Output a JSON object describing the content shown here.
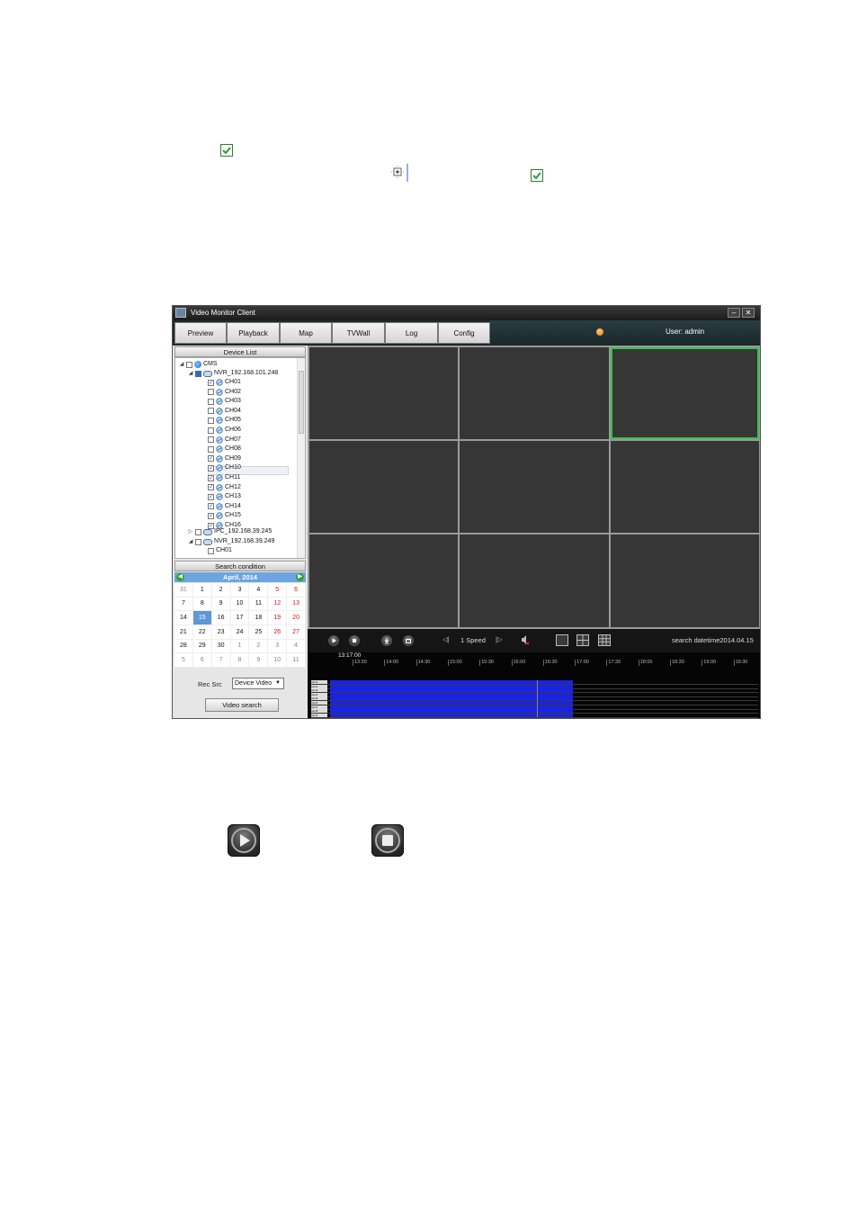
{
  "app": {
    "title": "Video Monitor Client",
    "nav_tabs": [
      "Preview",
      "Playback",
      "Map",
      "TVWall",
      "Log",
      "Config"
    ],
    "user": "User: admin",
    "colors": {
      "accent_active": "#35c24a",
      "record_bar": "#1a24e0",
      "calendar_header": "#6da5e0",
      "weekend": "#d11111"
    }
  },
  "device_list": {
    "header": "Device List",
    "root": "CMS",
    "devices": [
      {
        "name": "NVR_192.168.101.248",
        "expanded": true,
        "channels": [
          {
            "name": "CH01",
            "checked": true
          },
          {
            "name": "CH02",
            "checked": false
          },
          {
            "name": "CH03",
            "checked": false
          },
          {
            "name": "CH04",
            "checked": false
          },
          {
            "name": "CH05",
            "checked": false
          },
          {
            "name": "CH06",
            "checked": false
          },
          {
            "name": "CH07",
            "checked": false
          },
          {
            "name": "CH08",
            "checked": false
          },
          {
            "name": "CH09",
            "checked": true
          },
          {
            "name": "CH10",
            "checked": true
          },
          {
            "name": "CH11",
            "checked": true
          },
          {
            "name": "CH12",
            "checked": true
          },
          {
            "name": "CH13",
            "checked": true
          },
          {
            "name": "CH14",
            "checked": true
          },
          {
            "name": "CH15",
            "checked": true
          },
          {
            "name": "CH16",
            "checked": true
          }
        ]
      },
      {
        "name": "IPC_192.168.39.245",
        "expanded": false,
        "channels": []
      },
      {
        "name": "NVR_192.168.39.249",
        "expanded": true,
        "channels": [
          {
            "name": "CH01",
            "checked": false
          }
        ]
      }
    ]
  },
  "search": {
    "header": "Search condition",
    "month_label": "April,  2014",
    "calendar": [
      [
        "31",
        "1",
        "2",
        "3",
        "4",
        "5",
        "6"
      ],
      [
        "7",
        "8",
        "9",
        "10",
        "11",
        "12",
        "13"
      ],
      [
        "14",
        "15",
        "16",
        "17",
        "18",
        "19",
        "20"
      ],
      [
        "21",
        "22",
        "23",
        "24",
        "25",
        "26",
        "27"
      ],
      [
        "28",
        "29",
        "30",
        "1",
        "2",
        "3",
        "4"
      ],
      [
        "5",
        "6",
        "7",
        "8",
        "9",
        "10",
        "11"
      ]
    ],
    "selected_day": "15",
    "rec_src_label": "Rec Src",
    "rec_src_value": "Device Video",
    "search_button": "Video search"
  },
  "playback": {
    "speed": "1 Speed",
    "search_datetime": "search datetime2014.04.15",
    "cursor_time": "13:17:00",
    "ticks": [
      "13:30",
      "14:00",
      "14:30",
      "15:00",
      "15:30",
      "16:00",
      "16:30",
      "17:00",
      "17:30",
      "18:00",
      "18:30",
      "19:00",
      "19:30"
    ],
    "tracks": [
      "cam1",
      "cam2",
      "cam3",
      "cam4",
      "cam5",
      "cam6",
      "cam7",
      "cam8",
      "cam9"
    ]
  }
}
